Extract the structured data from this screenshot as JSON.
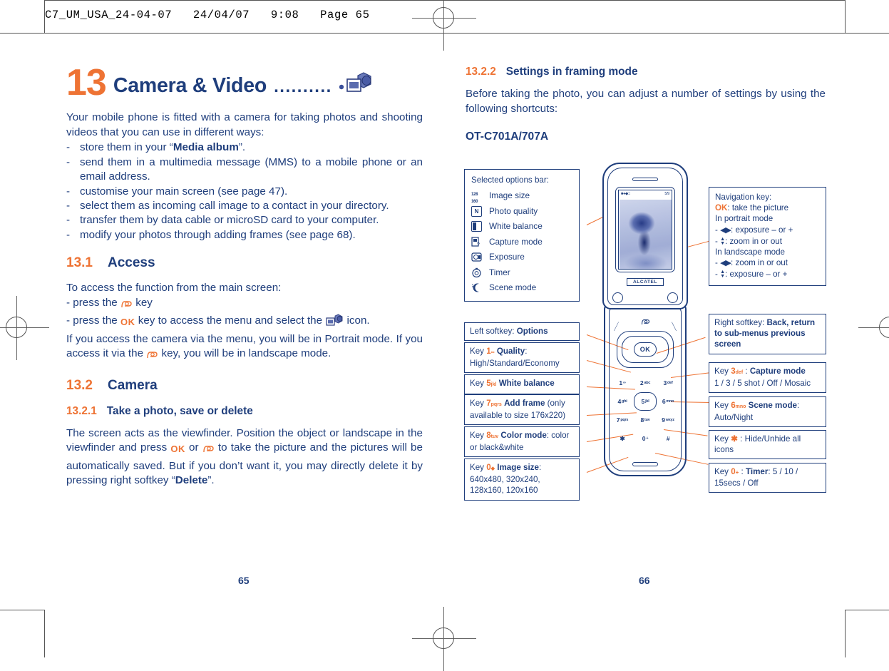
{
  "document": {
    "header_line": "C7_UM_USA_24-04-07   24/04/07   9:08   Page 65",
    "left_page_number": "65",
    "right_page_number": "66"
  },
  "colors": {
    "accent_orange": "#EE7334",
    "text_blue": "#1F3E7C"
  },
  "chapter": {
    "number": "13",
    "title": "Camera & Video",
    "dots": "..........",
    "icon": "camera-video-icon"
  },
  "left_column": {
    "intro": "Your mobile phone is fitted with a camera for taking photos and shooting videos that you can use in different ways:",
    "bullets": [
      {
        "dash": "-",
        "text_before": "store them in your “",
        "bold": "Media album",
        "text_after": "”."
      },
      {
        "dash": "-",
        "text_before": "send them in a multimedia message (MMS) to a mobile phone or an email address.",
        "bold": "",
        "text_after": ""
      },
      {
        "dash": "-",
        "text_before": "customise your main screen (see page 47).",
        "bold": "",
        "text_after": ""
      },
      {
        "dash": "-",
        "text_before": "select them as incoming call image to a contact in your directory.",
        "bold": "",
        "text_after": ""
      },
      {
        "dash": "-",
        "text_before": "transfer them by data cable or microSD card to your computer.",
        "bold": "",
        "text_after": ""
      },
      {
        "dash": "-",
        "text_before": "modify your photos through adding frames (see page 68).",
        "bold": "",
        "text_after": ""
      }
    ],
    "section_13_1": {
      "number": "13.1",
      "title": "Access"
    },
    "access_intro": "To access the function from the main screen:",
    "access_step_1_before": "- press the",
    "access_step_1_key": "camera-key-icon",
    "access_step_1_after": "key",
    "access_step_2_before": "- press the",
    "access_step_2_key": "OK",
    "access_step_2_mid": "key to access the menu and select the",
    "access_step_2_icon": "camera-video-icon",
    "access_step_2_after": "icon.",
    "access_note_part1": "If you access the camera via the menu, you will be in Portrait mode. If you access it via the",
    "access_note_key": "camera-key-icon",
    "access_note_part2": "key, you will be in landscape mode.",
    "section_13_2": {
      "number": "13.2",
      "title": "Camera"
    },
    "section_13_2_1": {
      "number": "13.2.1",
      "title": "Take a photo, save or delete"
    },
    "viewfinder_part1": "The screen acts as the viewfinder. Position the object or landscape in the viewfinder and press",
    "viewfinder_ok": "OK",
    "viewfinder_or": "or",
    "viewfinder_camkey": "camera-key-icon",
    "viewfinder_part2": "to take the picture and the pictures will be automatically saved. But if you don’t want it, you may directly delete it by pressing right softkey “",
    "viewfinder_bold": "Delete",
    "viewfinder_part3": "”."
  },
  "right_column": {
    "section_13_2_2": {
      "number": "13.2.2",
      "title": "Settings in framing mode"
    },
    "intro": "Before taking the photo, you can adjust a number of settings by using the following shortcuts:",
    "device_name": "OT-C701A/707A"
  },
  "figure": {
    "options_bar": {
      "heading": "Selected options bar:",
      "items": [
        {
          "icon": "image-size-icon",
          "label": "Image size",
          "icon_text_top": "128",
          "icon_text_bottom": "160"
        },
        {
          "icon": "photo-quality-icon",
          "label": "Photo quality",
          "icon_text_top": "N",
          "icon_text_bottom": ""
        },
        {
          "icon": "white-balance-icon",
          "label": "White balance",
          "icon_text_top": "",
          "icon_text_bottom": ""
        },
        {
          "icon": "capture-mode-icon",
          "label": "Capture mode",
          "icon_text_top": "",
          "icon_text_bottom": ""
        },
        {
          "icon": "exposure-icon",
          "label": "Exposure",
          "icon_text_top": "",
          "icon_text_bottom": ""
        },
        {
          "icon": "timer-icon",
          "label": "Timer",
          "icon_text_top": "",
          "icon_text_bottom": ""
        },
        {
          "icon": "scene-mode-icon",
          "label": "Scene mode",
          "icon_text_top": "",
          "icon_text_bottom": ""
        }
      ]
    },
    "navigation_key": {
      "heading": "Navigation key:",
      "ok_label": "OK",
      "ok_action": ": take the picture",
      "portrait_heading": "In portrait mode",
      "portrait_rows": [
        {
          "dash": "-",
          "arrows": "leftright",
          "text": ": exposure – or +"
        },
        {
          "dash": "-",
          "arrows": "updown",
          "text": ": zoom in or out"
        }
      ],
      "landscape_heading": "In landscape mode",
      "landscape_rows": [
        {
          "dash": "-",
          "arrows": "leftright",
          "text": ": zoom in or out"
        },
        {
          "dash": "-",
          "arrows": "updown",
          "text": ": exposure – or +"
        }
      ]
    },
    "left_callouts": [
      {
        "name": "left-softkey",
        "prefix": "Left softkey: ",
        "bold": "Options",
        "suffix": ""
      },
      {
        "name": "key-1-quality",
        "prefix": "Key ",
        "keynum": "1",
        "keysub": "∞",
        "bold": "Quality",
        "suffix": ": High/Standard/Economy"
      },
      {
        "name": "key-5-white-balance",
        "prefix": "Key ",
        "keynum": "5",
        "keysub": "jkl",
        "bold": "White balance",
        "suffix": ""
      },
      {
        "name": "key-7-add-frame",
        "prefix": "Key ",
        "keynum": "7",
        "keysub": "pqrs",
        "bold": "Add frame",
        "suffix": " (only available to size 176x220)"
      },
      {
        "name": "key-8-color-mode",
        "prefix": "Key ",
        "keynum": "8",
        "keysub": "tuv",
        "bold": "Color mode",
        "suffix": ": color or black&white"
      },
      {
        "name": "key-0-image-size",
        "prefix": "Key ",
        "keynum": "0",
        "keysub": "◆",
        "bold": "Image size",
        "suffix": ": 640x480, 320x240, 128x160, 120x160"
      }
    ],
    "right_callouts": [
      {
        "name": "right-softkey",
        "prefix": "Right softkey: ",
        "bold": "Back, return to sub-menus previous screen",
        "suffix": ""
      },
      {
        "name": "key-3-capture-mode",
        "prefix": "Key ",
        "keynum": "3",
        "keysub": "def",
        "mid": " : ",
        "bold": "Capture mode",
        "suffix": "1 / 3 / 5 shot / Off / Mosaic"
      },
      {
        "name": "key-6-scene-mode",
        "prefix": "Key ",
        "keynum": "6",
        "keysub": "mno",
        "bold": "Scene mode",
        "suffix": ": Auto/Night"
      },
      {
        "name": "key-star-hide-icons",
        "prefix": "Key ",
        "keynum": "✱",
        "keysub": "",
        "mid": " : ",
        "bold": "",
        "suffix": "Hide/Unhide all icons"
      },
      {
        "name": "key-0-timer",
        "prefix": "Key ",
        "keynum": "0",
        "keysub": "+",
        "mid": " : ",
        "bold": "Timer",
        "suffix": ": 5 / 10 / 15secs / Off"
      }
    ],
    "phone": {
      "brand": "ALCATEL",
      "ok_button": "OK",
      "status_left": "icons",
      "status_right": "5/9",
      "keys": [
        {
          "main": "1",
          "sub": "∞"
        },
        {
          "main": "2",
          "sub": "abc"
        },
        {
          "main": "3",
          "sub": "def"
        },
        {
          "main": "4",
          "sub": "ghi"
        },
        {
          "main": "5",
          "sub": "jkl"
        },
        {
          "main": "6",
          "sub": "mno"
        },
        {
          "main": "7",
          "sub": "pqrs"
        },
        {
          "main": "8",
          "sub": "tuv"
        },
        {
          "main": "9",
          "sub": "wxyz"
        },
        {
          "main": "✱",
          "sub": ""
        },
        {
          "main": "0",
          "sub": "+"
        },
        {
          "main": "#",
          "sub": ""
        }
      ]
    }
  }
}
